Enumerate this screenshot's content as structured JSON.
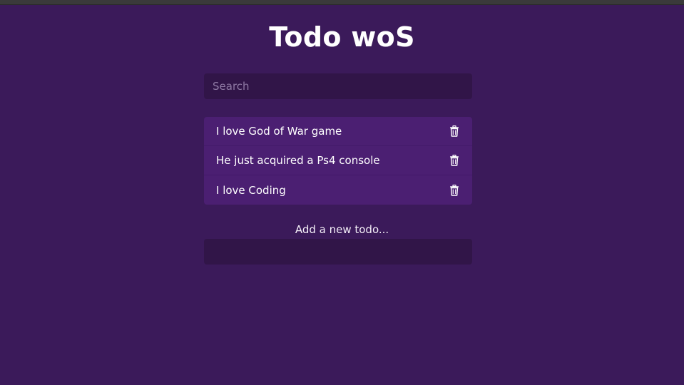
{
  "app": {
    "title": "Todo woS"
  },
  "search": {
    "placeholder": "Search",
    "value": ""
  },
  "todos": [
    {
      "text": "I love God of War game"
    },
    {
      "text": "He just acquired a Ps4 console"
    },
    {
      "text": "I love Coding"
    }
  ],
  "add_form": {
    "label": "Add a new todo...",
    "value": ""
  },
  "icons": {
    "delete": "trash-icon"
  },
  "colors": {
    "background": "#3b1a5a",
    "input_background": "#311548",
    "list_background": "#4b1f72",
    "text": "#ffffff"
  }
}
